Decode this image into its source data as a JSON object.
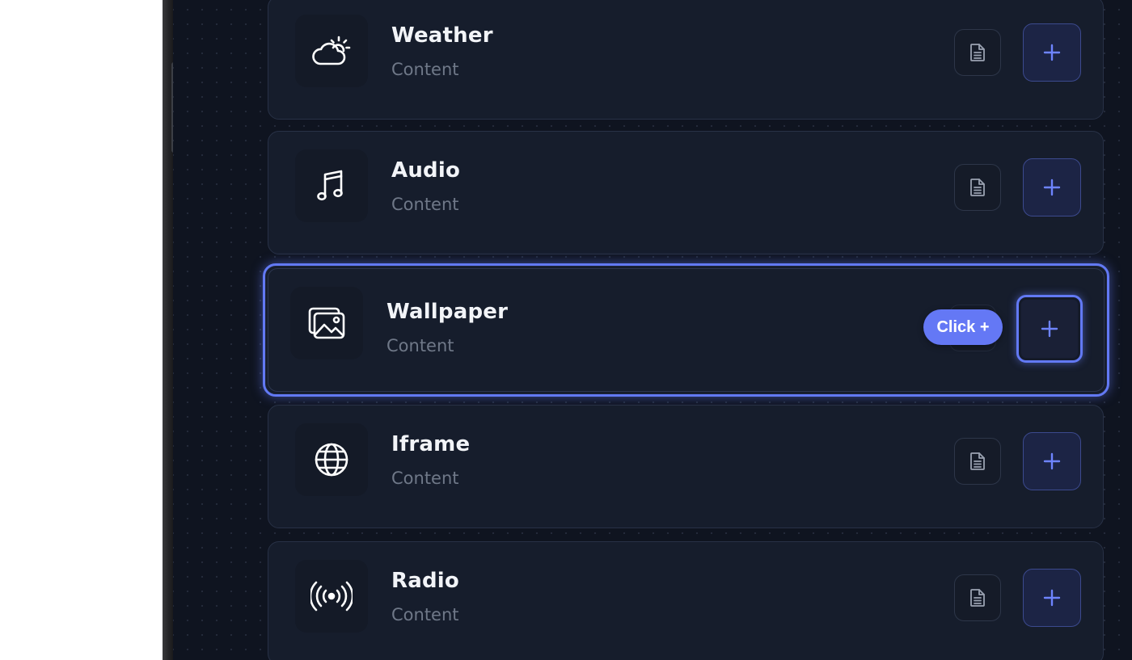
{
  "colors": {
    "accent": "#6279f4",
    "card_background": "#161d2c",
    "panel_background": "#0f1420",
    "title_text": "#f2f4f8",
    "subtitle_text": "#6f7888"
  },
  "cards": [
    {
      "title": "Weather",
      "subtitle": "Content",
      "icon": "cloud-sun-icon"
    },
    {
      "title": "Audio",
      "subtitle": "Content",
      "icon": "music-note-icon"
    },
    {
      "title": "Wallpaper",
      "subtitle": "Content",
      "icon": "image-icon",
      "selected": true
    },
    {
      "title": "Iframe",
      "subtitle": "Content",
      "icon": "globe-icon"
    },
    {
      "title": "Radio",
      "subtitle": "Content",
      "icon": "broadcast-icon"
    }
  ],
  "tooltip": {
    "label": "Click +"
  },
  "buttons": {
    "details_icon": "document-icon",
    "add_icon": "plus-icon"
  }
}
